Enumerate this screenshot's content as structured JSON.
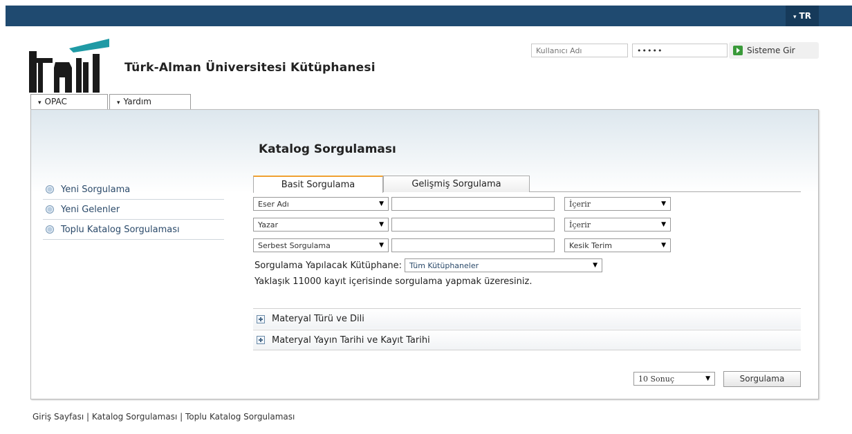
{
  "topbar": {
    "language": "TR",
    "language_caret": "▾"
  },
  "header": {
    "title": "Türk-Alman Üniversitesi Kütüphanesi"
  },
  "login": {
    "username_placeholder": "Kullanıcı Adı",
    "password_value": "•••••",
    "submit_label": "Sisteme Gir"
  },
  "menu": {
    "opac_label": "OPAC",
    "help_label": "Yardım",
    "caret": "▾"
  },
  "sidebar": {
    "items": [
      {
        "label": "Yeni Sorgulama"
      },
      {
        "label": "Yeni Gelenler"
      },
      {
        "label": "Toplu Katalog Sorgulaması"
      }
    ]
  },
  "main": {
    "heading": "Katalog Sorgulaması",
    "tabs": [
      {
        "label": "Basit Sorgulama",
        "active": true
      },
      {
        "label": "Gelişmiş Sorgulama",
        "active": false
      }
    ],
    "search_rows": [
      {
        "field": "Eser Adı",
        "term": "",
        "operator": "İçerir"
      },
      {
        "field": "Yazar",
        "term": "",
        "operator": "İçerir"
      },
      {
        "field": "Serbest Sorgulama",
        "term": "",
        "operator": "Kesik Terim"
      }
    ],
    "library_label": "Sorgulama Yapılacak Kütüphane:",
    "library_value": "Tüm Kütüphaneler",
    "info": "Yaklaşık 11000 kayıt içerisinde sorgulama yapmak üzeresiniz.",
    "accordions": [
      {
        "label": "Materyal Türü ve Dili"
      },
      {
        "label": "Materyal Yayın Tarihi ve Kayıt Tarihi"
      }
    ],
    "results_value": "10 Sonuç",
    "search_button": "Sorgulama",
    "dropdown_arrow": "▼"
  },
  "footer": {
    "links": [
      "Giriş Sayfası",
      "Katalog Sorgulaması",
      "Toplu Katalog Sorgulaması"
    ],
    "separator": " | "
  },
  "colors": {
    "topbar": "#1f4a70",
    "accent_tab": "#f0a030",
    "logo_teal": "#1f9aa5",
    "logo_dark": "#1a1a1a",
    "login_go": "#3a9a3a"
  },
  "icons": {
    "logo": "tau-logo",
    "login_go": "play-arrow-icon",
    "accordion": "plus-box-icon",
    "sidebar_bullet": "radio-circle-icon"
  }
}
